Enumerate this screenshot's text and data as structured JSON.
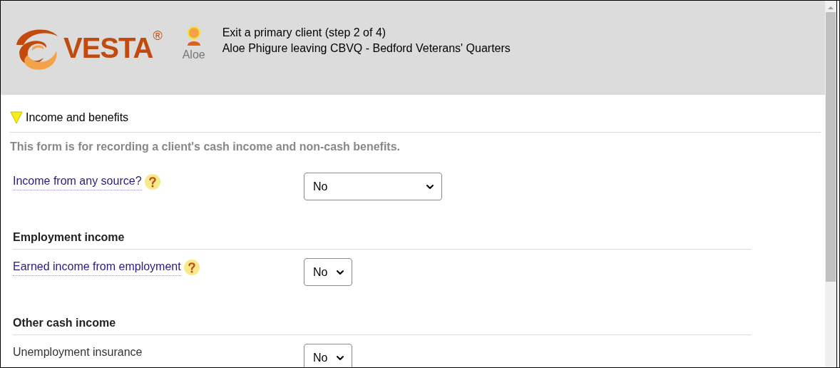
{
  "header": {
    "logo": "VESTA",
    "logo_mark": "®",
    "user": "Aloe",
    "title": "Exit a primary client (step 2 of 4)",
    "subtitle": "Aloe Phigure leaving CBVQ - Bedford Veterans' Quarters"
  },
  "section": {
    "title": "Income and benefits",
    "expanded": true,
    "description": "This form is for recording a client's cash income and non-cash benefits."
  },
  "main_question": {
    "label": "Income from any source?",
    "help": true,
    "value": "No"
  },
  "groups": [
    {
      "heading": "Employment income",
      "fields": [
        {
          "label": "Earned income from employment",
          "help": true,
          "value": "No"
        }
      ]
    },
    {
      "heading": "Other cash income",
      "fields": [
        {
          "label": "Unemployment insurance",
          "help": false,
          "value": "No"
        }
      ]
    }
  ]
}
